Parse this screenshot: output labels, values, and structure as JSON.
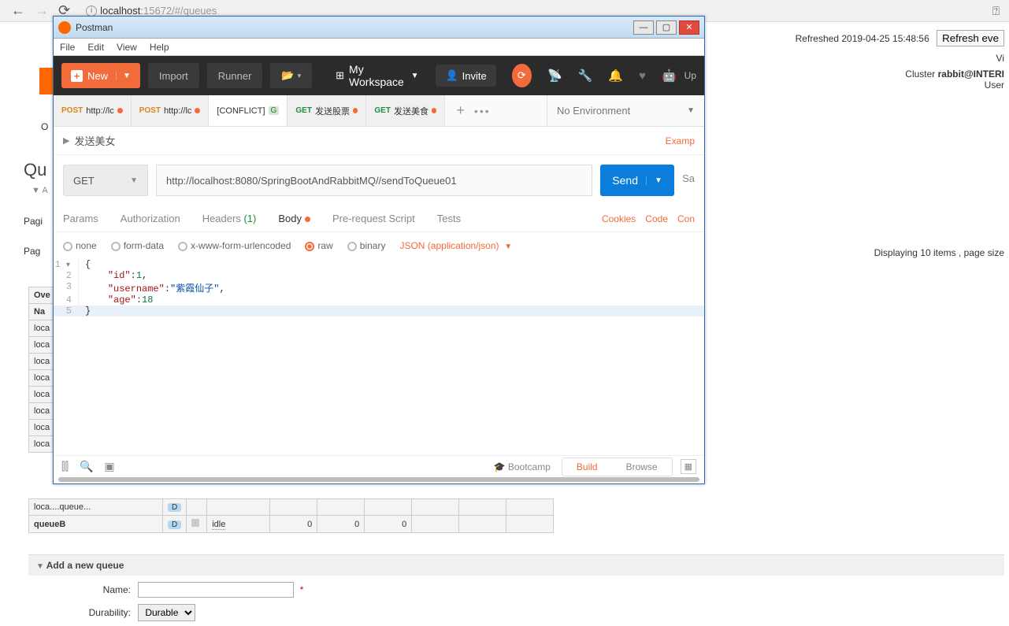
{
  "browser": {
    "url_host": "localhost",
    "url_rest": ":15672/#/queues"
  },
  "rabbitmq": {
    "refreshed": "Refreshed 2019-04-25 15:48:56",
    "refresh_btn": "Refresh eve",
    "vi": "Vi",
    "cluster_label": "Cluster ",
    "cluster_name": "rabbit@INTERI",
    "user_label": "User",
    "nav_o": "O",
    "queues_heading": "Qu",
    "filter_a": "A",
    "pagi1": "Pagi",
    "pagi2": "Pag",
    "displaying": "Displaying 10 items , page size",
    "ove": "Ove",
    "name_hdr": "Na",
    "row_prefix": "loca",
    "row_long": "loca....queue...",
    "row_queueB": "queueB",
    "d_badge": "D",
    "state_idle": "idle",
    "zero": "0",
    "add_queue_hdr": "Add a new queue",
    "name_label": "Name:",
    "durability_label": "Durability:",
    "durability_value": "Durable"
  },
  "postman": {
    "title": "Postman",
    "menus": [
      "File",
      "Edit",
      "View",
      "Help"
    ],
    "new_btn": "New",
    "import_btn": "Import",
    "runner_btn": "Runner",
    "workspace": "My Workspace",
    "invite": "Invite",
    "upgrade": "Up",
    "tabs": [
      {
        "method": "POST",
        "label": "http://lc"
      },
      {
        "method": "POST",
        "label": "http://lc"
      },
      {
        "conflict": "[CONFLICT]",
        "g": "G"
      },
      {
        "method": "GET",
        "label": "发送股票"
      },
      {
        "method": "GET",
        "label": "发送美食"
      }
    ],
    "env": "No Environment",
    "req_name": "发送美女",
    "examples": "Examp",
    "method": "GET",
    "url": "http://localhost:8080/SpringBootAndRabbitMQ//sendToQueue01",
    "send": "Send",
    "save": "Sa",
    "subtabs": {
      "params": "Params",
      "authorization": "Authorization",
      "headers": "Headers",
      "headers_count": "(1)",
      "body": "Body",
      "prerequest": "Pre-request Script",
      "tests": "Tests",
      "cookies": "Cookies",
      "code": "Code",
      "con": "Con"
    },
    "body_opts": {
      "none": "none",
      "form": "form-data",
      "urlenc": "x-www-form-urlencoded",
      "raw": "raw",
      "binary": "binary",
      "json": "JSON (application/json)"
    },
    "editor_lines": [
      {
        "n": 1,
        "fold": true,
        "text_html": "{"
      },
      {
        "n": 2,
        "text_html": "    <span class=\"key\">\"id\"</span>:<span class=\"num\">1</span>,"
      },
      {
        "n": 3,
        "text_html": "    <span class=\"key\">\"username\"</span>:<span class=\"str\">\"紫霞仙子\"</span>,"
      },
      {
        "n": 4,
        "text_html": "    <span class=\"key\">\"age\"</span>:<span class=\"num\">18</span>"
      },
      {
        "n": 5,
        "hl": true,
        "text_html": "}"
      }
    ],
    "footer": {
      "bootcamp": "Bootcamp",
      "build": "Build",
      "browse": "Browse"
    }
  }
}
